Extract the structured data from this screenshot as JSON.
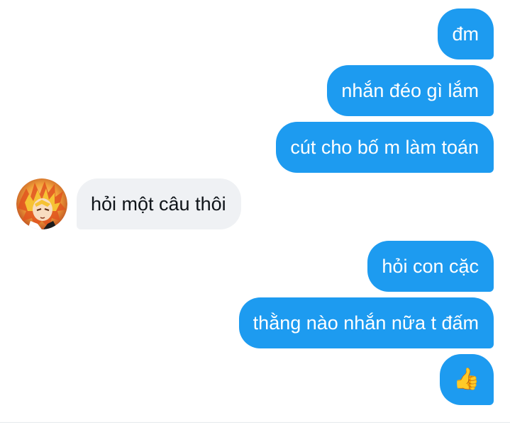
{
  "messages": [
    {
      "side": "sent",
      "text": "đm"
    },
    {
      "side": "sent",
      "text": "nhắn đéo gì lắm"
    },
    {
      "side": "sent",
      "text": "cút cho bố m làm toán"
    },
    {
      "side": "received",
      "text": "hỏi một câu thôi"
    },
    {
      "side": "sent",
      "text": "hỏi con cặc"
    },
    {
      "side": "sent",
      "text": "thằng nào nhắn nữa t đấm"
    },
    {
      "side": "sent",
      "text": "👍"
    }
  ],
  "avatar": {
    "icon": "anime-character-avatar"
  },
  "colors": {
    "sent_bubble": "#1d9bf0",
    "received_bubble": "#eff1f4",
    "sent_text": "#ffffff",
    "received_text": "#0f1419"
  }
}
